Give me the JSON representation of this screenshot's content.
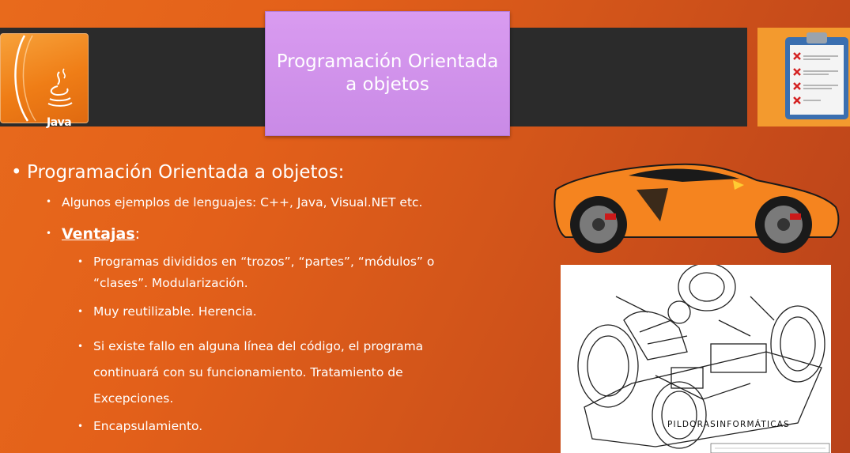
{
  "header": {
    "title_line1": "Programación Orientada",
    "title_line2": "a objetos",
    "java_label": "Java"
  },
  "content": {
    "heading_bullet": "Programación Orientada a objetos:",
    "examples": "Algunos ejemplos de lenguajes: C++, Java, Visual.NET etc.",
    "advantages_label": "Ventajas",
    "advantages_suffix": ":",
    "advantages": [
      "Programas divididos en “trozos”, “partes”, “módulos” o “clases”. Modularización.",
      "Muy reutilizable. Herencia.",
      "Si existe fallo en alguna línea del código, el programa continuará con su funcionamiento. Tratamiento de Excepciones.",
      "Encapsulamiento."
    ]
  },
  "watermark": "PILDORASINFORMÁTICAS",
  "colors": {
    "background": "#e3601a",
    "title_box": "#d99bf0",
    "band": "#2b2b2b",
    "car_body": "#f5841f"
  },
  "icons": [
    "java-logo-icon",
    "clipboard-checklist-icon",
    "sports-car-image",
    "rc-car-diagram-image"
  ]
}
